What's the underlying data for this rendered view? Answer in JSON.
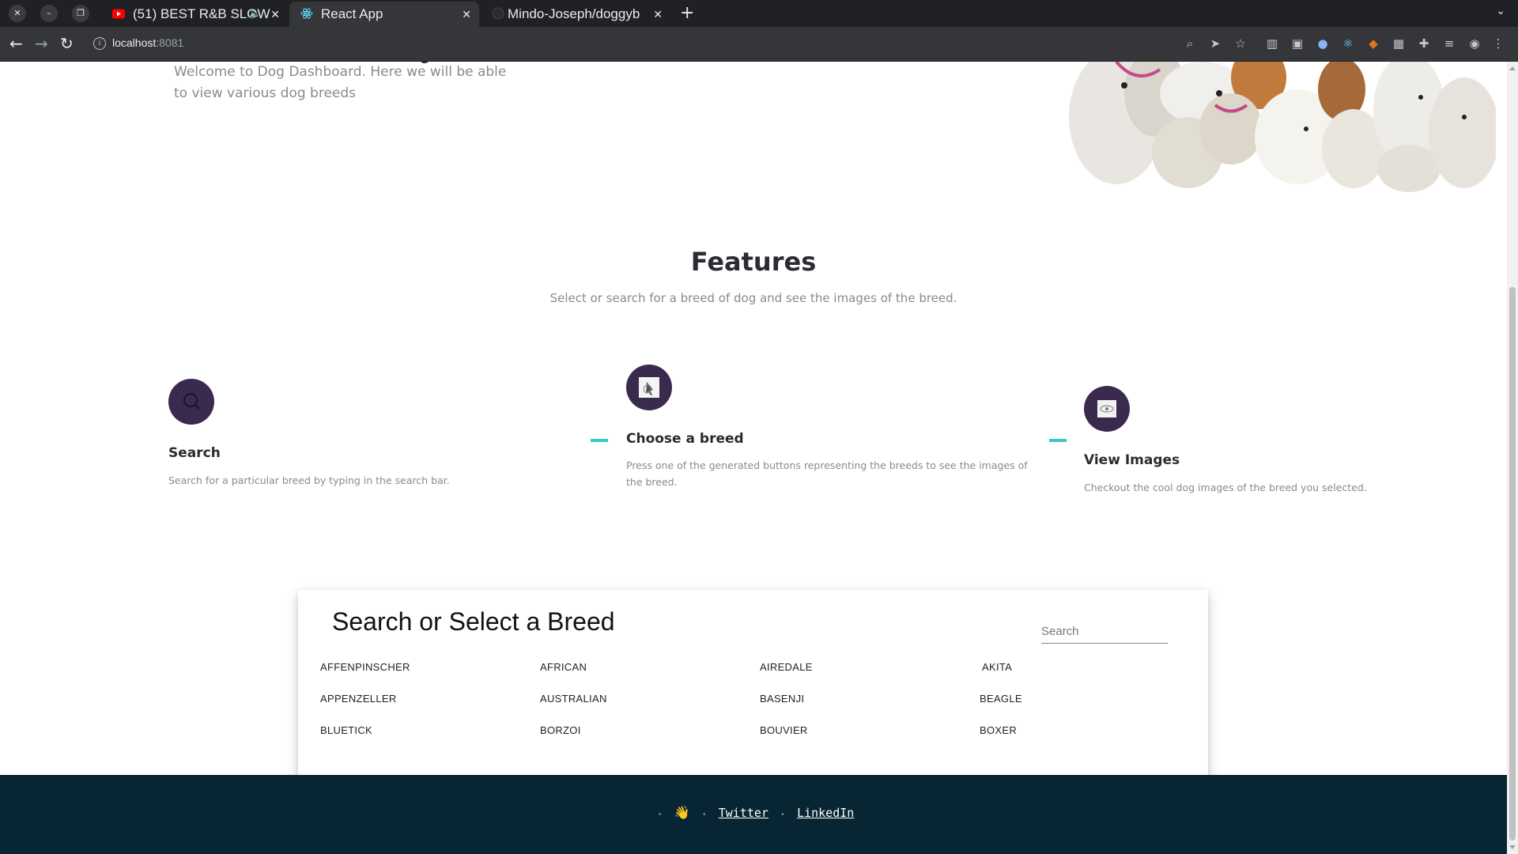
{
  "browser": {
    "tabs": [
      {
        "title": "(51) BEST R&B SLOW",
        "active": false
      },
      {
        "title": "React App",
        "active": true
      },
      {
        "title": "Mindo-Joseph/doggyb",
        "active": false
      }
    ],
    "url_host": "localhost",
    "url_port": ":8081"
  },
  "hero": {
    "intro": "Welcome to Dog Dashboard. Here we will be able to view various dog breeds"
  },
  "features": {
    "title": "Features",
    "subtitle": "Select or search for a breed of dog and see the images of the breed.",
    "items": [
      {
        "title": "Search",
        "text": "Search for a particular breed by typing in the search bar.",
        "icon": "search-icon"
      },
      {
        "title": "Choose a breed",
        "text": "Press one of the generated buttons representing the breeds to see the images of the breed.",
        "icon": "pointer-icon"
      },
      {
        "title": "View Images",
        "text": "Checkout the cool dog images of the breed you selected.",
        "icon": "eye-icon"
      }
    ]
  },
  "breeds_card": {
    "title": "Search or Select a Breed",
    "search_placeholder": "Search",
    "breeds": [
      "AFFENPINSCHER",
      "AFRICAN",
      "AIREDALE",
      "AKITA",
      "APPENZELLER",
      "AUSTRALIAN",
      "BASENJI",
      "BEAGLE",
      "BLUETICK",
      "BORZOI",
      "BOUVIER",
      "BOXER"
    ]
  },
  "footer": {
    "wave": "👋",
    "twitter": "Twitter",
    "linkedin": "LinkedIn"
  },
  "colors": {
    "accent": "#3a2b4e",
    "dash": "#3cc8c8",
    "footer_bg": "#072532"
  }
}
